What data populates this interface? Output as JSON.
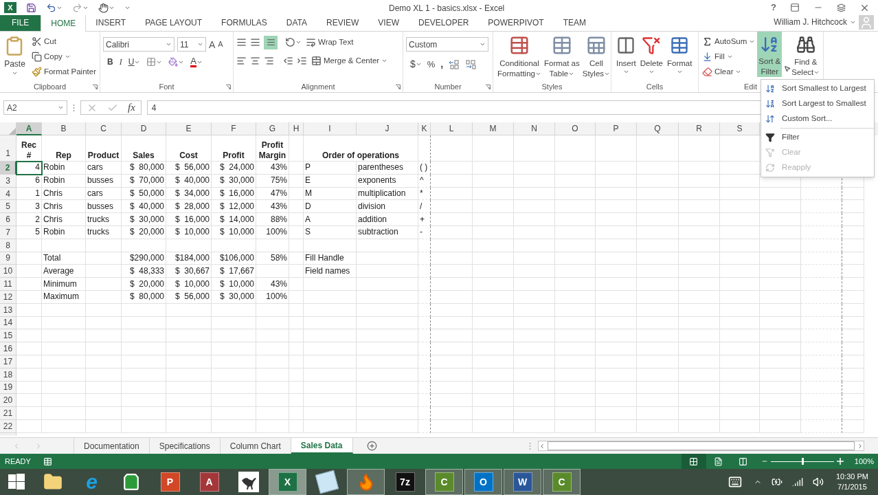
{
  "title_bar": {
    "app_letter": "X",
    "title": "Demo XL 1 - basics.xlsx - Excel",
    "help": "?"
  },
  "ribbon_tabs": [
    {
      "label": "FILE",
      "kind": "file",
      "selected": false
    },
    {
      "label": "HOME",
      "kind": "tab",
      "selected": true
    },
    {
      "label": "INSERT",
      "kind": "tab",
      "selected": false
    },
    {
      "label": "PAGE LAYOUT",
      "kind": "tab",
      "selected": false
    },
    {
      "label": "FORMULAS",
      "kind": "tab",
      "selected": false
    },
    {
      "label": "DATA",
      "kind": "tab",
      "selected": false
    },
    {
      "label": "REVIEW",
      "kind": "tab",
      "selected": false
    },
    {
      "label": "VIEW",
      "kind": "tab",
      "selected": false
    },
    {
      "label": "DEVELOPER",
      "kind": "tab",
      "selected": false
    },
    {
      "label": "POWERPIVOT",
      "kind": "tab",
      "selected": false
    },
    {
      "label": "TEAM",
      "kind": "tab",
      "selected": false
    }
  ],
  "user": "William J. Hitchcock",
  "ribbon": {
    "clipboard": {
      "label": "Clipboard",
      "paste": "Paste",
      "cut": "Cut",
      "copy": "Copy",
      "format_painter": "Format Painter"
    },
    "font": {
      "label": "Font",
      "font_name": "Calibri",
      "font_size": "11",
      "grow": "A",
      "shrink": "A",
      "bold": "B",
      "italic": "I",
      "underline": "U",
      "font_color": "A"
    },
    "alignment": {
      "label": "Alignment",
      "bottom_align": {
        "selected": true
      },
      "wrap_text": "Wrap Text",
      "merge_center": "Merge & Center"
    },
    "number": {
      "label": "Number",
      "format": "Custom",
      "currency": "$",
      "percent": "%",
      "comma": ","
    },
    "styles": {
      "label": "Styles",
      "buttons": [
        {
          "lines": [
            "Conditional",
            "Formatting"
          ],
          "kind": "conditional"
        },
        {
          "lines": [
            "Format as",
            "Table"
          ],
          "kind": "table"
        },
        {
          "lines": [
            "Cell",
            "Styles"
          ],
          "kind": "cell-styles"
        }
      ]
    },
    "cells": {
      "label": "Cells",
      "buttons": [
        {
          "label": "Insert",
          "kind": "insert"
        },
        {
          "label": "Delete",
          "kind": "delete"
        },
        {
          "label": "Format",
          "kind": "format"
        }
      ]
    },
    "editing": {
      "label": "Edit",
      "autosum": "AutoSum",
      "fill": "Fill",
      "clear": "Clear",
      "sort_filter": {
        "lines": [
          "Sort &",
          "Filter"
        ],
        "selected": true
      },
      "find_select": {
        "lines": [
          "Find &",
          "Select"
        ]
      }
    }
  },
  "formula_bar": {
    "name_box": "A2",
    "function_label": "fx",
    "value": "4"
  },
  "columns": [
    {
      "letter": "A",
      "kind": "number",
      "selected": true
    },
    {
      "letter": "B",
      "kind": "text",
      "selected": false
    },
    {
      "letter": "C",
      "kind": "text",
      "selected": false
    },
    {
      "letter": "D",
      "kind": "number",
      "selected": false
    },
    {
      "letter": "E",
      "kind": "number",
      "selected": false
    },
    {
      "letter": "F",
      "kind": "number",
      "selected": false
    },
    {
      "letter": "G",
      "kind": "number",
      "selected": false
    },
    {
      "letter": "H",
      "kind": "text",
      "selected": false
    },
    {
      "letter": "I",
      "kind": "text",
      "selected": false
    },
    {
      "letter": "J",
      "kind": "text",
      "selected": false
    },
    {
      "letter": "K",
      "kind": "text",
      "selected": false
    },
    {
      "letter": "L",
      "kind": "text",
      "selected": false
    },
    {
      "letter": "M",
      "kind": "text",
      "selected": false
    },
    {
      "letter": "N",
      "kind": "text",
      "selected": false
    },
    {
      "letter": "O",
      "kind": "text",
      "selected": false
    },
    {
      "letter": "P",
      "kind": "text",
      "selected": false
    },
    {
      "letter": "Q",
      "kind": "text",
      "selected": false
    },
    {
      "letter": "R",
      "kind": "text",
      "selected": false
    },
    {
      "letter": "S",
      "kind": "text",
      "selected": false
    }
  ],
  "rows": [
    {
      "number": "1",
      "kind": "header",
      "selected": false,
      "cells": {
        "A": "Rec #",
        "B": "Rep",
        "C": "Product",
        "D": "Sales",
        "E": "Cost",
        "F": "Profit",
        "G": "Profit Margin",
        "I": {
          "text": "Order of operations",
          "merged": true
        }
      }
    },
    {
      "number": "2",
      "kind": "data",
      "selected": true,
      "cells": {
        "A": "4",
        "B": "Robin",
        "C": "cars",
        "D": "$  80,000",
        "E": "$  56,000",
        "F": "$  24,000",
        "G": "43%",
        "I": "P",
        "J": "parentheses",
        "K": "( )"
      }
    },
    {
      "number": "3",
      "kind": "data",
      "selected": false,
      "cells": {
        "A": "6",
        "B": "Robin",
        "C": "busses",
        "D": "$  70,000",
        "E": "$  40,000",
        "F": "$  30,000",
        "G": "75%",
        "I": "E",
        "J": "exponents",
        "K": "^"
      }
    },
    {
      "number": "4",
      "kind": "data",
      "selected": false,
      "cells": {
        "A": "1",
        "B": "Chris",
        "C": "cars",
        "D": "$  50,000",
        "E": "$  34,000",
        "F": "$  16,000",
        "G": "47%",
        "I": "M",
        "J": "multiplication",
        "K": "*"
      }
    },
    {
      "number": "5",
      "kind": "data",
      "selected": false,
      "cells": {
        "A": "3",
        "B": "Chris",
        "C": "busses",
        "D": "$  40,000",
        "E": "$  28,000",
        "F": "$  12,000",
        "G": "43%",
        "I": "D",
        "J": "division",
        "K": "/"
      }
    },
    {
      "number": "6",
      "kind": "data",
      "selected": false,
      "cells": {
        "A": "2",
        "B": "Chris",
        "C": "trucks",
        "D": "$  30,000",
        "E": "$  16,000",
        "F": "$  14,000",
        "G": "88%",
        "I": "A",
        "J": "addition",
        "K": "+"
      }
    },
    {
      "number": "7",
      "kind": "data",
      "selected": false,
      "cells": {
        "A": "5",
        "B": "Robin",
        "C": "trucks",
        "D": "$  20,000",
        "E": "$  10,000",
        "F": "$  10,000",
        "G": "100%",
        "I": "S",
        "J": "subtraction",
        "K": "-"
      }
    },
    {
      "number": "8",
      "kind": "data",
      "selected": false,
      "cells": {}
    },
    {
      "number": "9",
      "kind": "data",
      "selected": false,
      "cells": {
        "B": "Total",
        "D": "$290,000",
        "E": "$184,000",
        "F": "$106,000",
        "G": "58%",
        "I": "Fill Handle"
      }
    },
    {
      "number": "10",
      "kind": "data",
      "selected": false,
      "cells": {
        "B": "Average",
        "D": "$  48,333",
        "E": "$  30,667",
        "F": "$  17,667",
        "I": "Field names"
      }
    },
    {
      "number": "11",
      "kind": "data",
      "selected": false,
      "cells": {
        "B": "Minimum",
        "D": "$  20,000",
        "E": "$  10,000",
        "F": "$  10,000",
        "G": "43%"
      }
    },
    {
      "number": "12",
      "kind": "data",
      "selected": false,
      "cells": {
        "B": "Maximum",
        "D": "$  80,000",
        "E": "$  56,000",
        "F": "$  30,000",
        "G": "100%"
      }
    },
    {
      "number": "13",
      "kind": "data",
      "selected": false,
      "cells": {}
    },
    {
      "number": "14",
      "kind": "data",
      "selected": false,
      "cells": {}
    },
    {
      "number": "15",
      "kind": "data",
      "selected": false,
      "cells": {}
    },
    {
      "number": "16",
      "kind": "data",
      "selected": false,
      "cells": {}
    },
    {
      "number": "17",
      "kind": "data",
      "selected": false,
      "cells": {}
    },
    {
      "number": "18",
      "kind": "data",
      "selected": false,
      "cells": {}
    },
    {
      "number": "19",
      "kind": "data",
      "selected": false,
      "cells": {}
    },
    {
      "number": "20",
      "kind": "data",
      "selected": false,
      "cells": {}
    },
    {
      "number": "21",
      "kind": "data",
      "selected": false,
      "cells": {}
    },
    {
      "number": "22",
      "kind": "data",
      "selected": false,
      "cells": {}
    }
  ],
  "sort_menu": [
    {
      "label": "Sort Smallest to Largest",
      "kind": "sort-asc",
      "disabled": false,
      "divider_above": false
    },
    {
      "label": "Sort Largest to Smallest",
      "kind": "sort-desc",
      "disabled": false,
      "divider_above": false
    },
    {
      "label": "Custom Sort...",
      "kind": "custom-sort",
      "disabled": false,
      "divider_above": false
    },
    {
      "label": "Filter",
      "kind": "filter",
      "disabled": false,
      "divider_above": true
    },
    {
      "label": "Clear",
      "kind": "clear",
      "disabled": true,
      "divider_above": false
    },
    {
      "label": "Reapply",
      "kind": "reapply",
      "disabled": true,
      "divider_above": false
    }
  ],
  "sheet_tabs": [
    {
      "label": "Documentation",
      "selected": false
    },
    {
      "label": "Specifications",
      "selected": false
    },
    {
      "label": "Column Chart",
      "selected": false
    },
    {
      "label": "Sales Data",
      "selected": true
    }
  ],
  "status_bar": {
    "status": "READY",
    "views": [
      {
        "kind": "normal",
        "selected": true
      },
      {
        "kind": "page-layout",
        "selected": false
      },
      {
        "kind": "page-break",
        "selected": false
      }
    ],
    "zoom": {
      "level": 0.5,
      "reading": "100%"
    }
  },
  "taskbar": {
    "apps": [
      {
        "kind": "explorer",
        "running": false,
        "selected": false
      },
      {
        "kind": "ie",
        "letter": "e",
        "running": false,
        "selected": false
      },
      {
        "kind": "store",
        "running": false,
        "selected": false
      },
      {
        "kind": "powerpoint",
        "letter": "P",
        "running": false,
        "selected": false
      },
      {
        "kind": "access",
        "letter": "A",
        "running": false,
        "selected": false
      },
      {
        "kind": "dinosaur",
        "running": false,
        "selected": false
      },
      {
        "kind": "excel",
        "letter": "X",
        "running": true,
        "selected": true
      },
      {
        "kind": "notepad",
        "running": false,
        "selected": false
      },
      {
        "kind": "firefox",
        "running": true,
        "selected": false
      },
      {
        "kind": "archiver",
        "letter": "7z",
        "running": false,
        "selected": false
      },
      {
        "kind": "camtasia",
        "letter": "C",
        "running": true,
        "selected": false
      },
      {
        "kind": "outlook",
        "letter": "O",
        "running": true,
        "selected": false
      },
      {
        "kind": "word",
        "letter": "W",
        "running": true,
        "selected": false
      },
      {
        "kind": "camtasia",
        "letter": "C",
        "running": true,
        "selected": false
      }
    ],
    "time": "10:30 PM",
    "date": "7/1/2015"
  }
}
